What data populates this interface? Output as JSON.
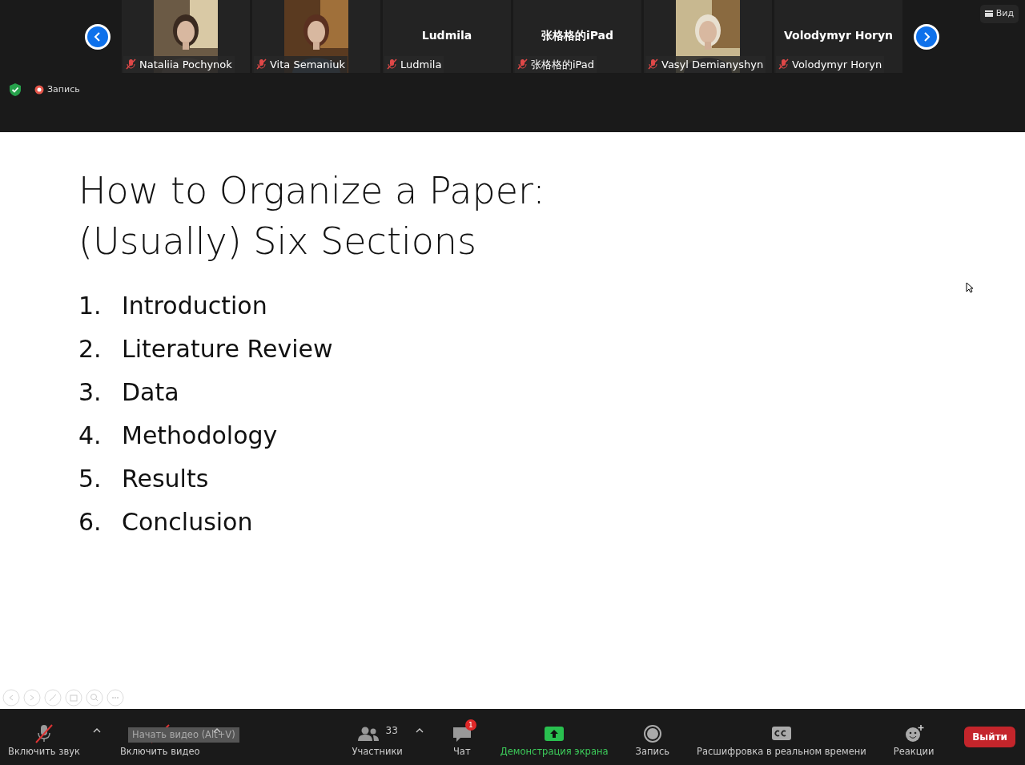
{
  "top_bar": {
    "recording_label": "Запись",
    "view_button": "Вид"
  },
  "participants": [
    {
      "kind": "video",
      "name": "Nataliia Pochynok",
      "muted": true
    },
    {
      "kind": "video",
      "name": "Vita Semaniuk",
      "muted": true
    },
    {
      "kind": "name",
      "display_name": "Ludmila",
      "name": "Ludmila",
      "muted": true
    },
    {
      "kind": "name",
      "display_name": "张格格的iPad",
      "name": "张格格的iPad",
      "muted": true
    },
    {
      "kind": "video",
      "name": "Vasyl Demianyshyn",
      "muted": true
    },
    {
      "kind": "name",
      "display_name": "Volodymyr Horyn",
      "name": "Volodymyr Horyn",
      "muted": true
    }
  ],
  "slide": {
    "title_lines": [
      "How to Organize a Paper:",
      "(Usually) Six Sections"
    ],
    "items": [
      {
        "number": "1.",
        "text": "Introduction"
      },
      {
        "number": "2.",
        "text": "Literature Review"
      },
      {
        "number": "3.",
        "text": "Data"
      },
      {
        "number": "4.",
        "text": "Methodology"
      },
      {
        "number": "5.",
        "text": "Results"
      },
      {
        "number": "6.",
        "text": "Conclusion"
      }
    ]
  },
  "toolbar": {
    "left": [
      {
        "kind": "mic",
        "label": "Включить звук",
        "off": true,
        "caret": true
      },
      {
        "kind": "video",
        "label": "Включить видео",
        "off": true,
        "caret": true
      }
    ],
    "center": [
      {
        "kind": "participants",
        "label": "Участники",
        "count": "33",
        "caret": true,
        "highlighted": false
      },
      {
        "kind": "chat",
        "label": "Чат",
        "badge": "1",
        "caret": false,
        "highlighted": false
      },
      {
        "kind": "share",
        "label": "Демонстрация экрана",
        "caret": false,
        "highlighted": true
      },
      {
        "kind": "record",
        "label": "Запись",
        "caret": false,
        "highlighted": false
      },
      {
        "kind": "cc",
        "label": "Расшифровка в реальном времени",
        "caret": false,
        "highlighted": false
      },
      {
        "kind": "reactions",
        "label": "Реакции",
        "caret": false,
        "highlighted": false
      }
    ],
    "tooltip": "Начать видео (Alt+V)",
    "leave_button": "Выйти"
  }
}
